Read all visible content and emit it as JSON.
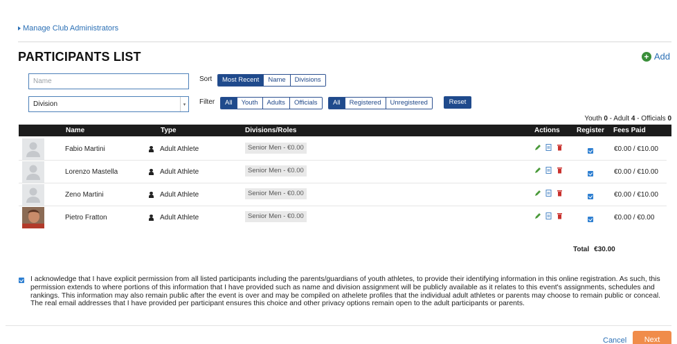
{
  "nav": {
    "manage_admins": "Manage Club Administrators"
  },
  "page": {
    "title": "PARTICIPANTS LIST",
    "add_label": "Add"
  },
  "search": {
    "placeholder": "Name"
  },
  "division_select": {
    "value": "Division"
  },
  "sort": {
    "label": "Sort",
    "options": [
      {
        "label": "Most Recent",
        "active": true
      },
      {
        "label": "Name",
        "active": false
      },
      {
        "label": "Divisions",
        "active": false
      }
    ]
  },
  "filter": {
    "label": "Filter",
    "type_options": [
      {
        "label": "All",
        "active": true
      },
      {
        "label": "Youth",
        "active": false
      },
      {
        "label": "Adults",
        "active": false
      },
      {
        "label": "Officials",
        "active": false
      }
    ],
    "status_options": [
      {
        "label": "All",
        "active": true
      },
      {
        "label": "Registered",
        "active": false
      },
      {
        "label": "Unregistered",
        "active": false
      }
    ],
    "reset_label": "Reset"
  },
  "counts": {
    "youth_label": "Youth",
    "youth": "0",
    "adult_label": "Adult",
    "adult": "4",
    "officials_label": "Officials",
    "officials": "0"
  },
  "table": {
    "columns": {
      "name": "Name",
      "type": "Type",
      "divisions": "Divisions/Roles",
      "actions": "Actions",
      "register": "Register",
      "fees": "Fees Paid"
    },
    "rows": [
      {
        "name": "Fabio Martini",
        "type": "Adult Athlete",
        "division": "Senior Men - €0.00",
        "fees": "€0.00 / €10.00",
        "registered": true,
        "has_photo": false
      },
      {
        "name": "Lorenzo Mastella",
        "type": "Adult Athlete",
        "division": "Senior Men - €0.00",
        "fees": "€0.00 / €10.00",
        "registered": true,
        "has_photo": false
      },
      {
        "name": "Zeno Martini",
        "type": "Adult Athlete",
        "division": "Senior Men - €0.00",
        "fees": "€0.00 / €10.00",
        "registered": true,
        "has_photo": false
      },
      {
        "name": "Pietro Fratton",
        "type": "Adult Athlete",
        "division": "Senior Men - €0.00",
        "fees": "€0.00 / €0.00",
        "registered": true,
        "has_photo": true
      }
    ]
  },
  "total": {
    "label": "Total",
    "value": "€30.00"
  },
  "acknowledgement": {
    "checked": true,
    "text": "I acknowledge that I have explicit permission from all listed participants including the parents/guardians of youth athletes, to provide their identifying information in this online registration. As such, this permission extends to where portions of this information that I have provided such as name and division assignment will be publicly available as it relates to this event's assignments, schedules and rankings. This information may also remain public after the event is over and may be compiled on athelete profiles that the individual adult athletes or parents may choose to remain public or conceal. The real email addresses that I have provided per participant ensures this choice and other privacy options remain open to the adult participants or parents."
  },
  "footer": {
    "cancel_label": "Cancel",
    "next_label": "Next"
  },
  "colors": {
    "primary": "#1f4a8c",
    "link": "#2a6fb5",
    "add_icon": "#3a8f3a",
    "next_button": "#f08c4a",
    "checkbox": "#2e7fd1"
  },
  "icons": [
    "caret-right-icon",
    "plus-circle-icon",
    "chevron-down-icon",
    "person-icon",
    "pencil-icon",
    "document-icon",
    "trash-icon",
    "checkbox-checked-icon",
    "avatar-placeholder-icon"
  ]
}
